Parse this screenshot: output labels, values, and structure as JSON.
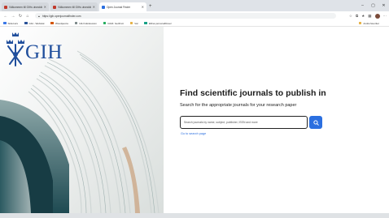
{
  "browser": {
    "tabs": [
      {
        "label": "Välkommen till GIHs utvecklings...",
        "favicon_color": "#c0392b",
        "active": false
      },
      {
        "label": "Välkommen till GIHs utvecklings...",
        "favicon_color": "#c0392b",
        "active": false
      },
      {
        "label": "Open Journal Finder",
        "favicon_color": "#2b6fe0",
        "active": true
      }
    ],
    "new_tab_icon": "plus-icon",
    "address": "https://gih.openjournalfinder.com",
    "bookmarks": [
      {
        "label": "Sida kurs",
        "color": "#3b78e7"
      },
      {
        "label": "GIH - Webstat",
        "color": "#2a5298"
      },
      {
        "label": "Woodpecca",
        "color": "#d35400"
      },
      {
        "label": "GIH Gävlesoran",
        "color": "#7f8c8d"
      },
      {
        "label": "GIHb: GetFruit",
        "color": "#27ae60"
      },
      {
        "label": "Val",
        "color": "#e67e22"
      },
      {
        "label": "Ellina personalblovel",
        "color": "#16a085"
      }
    ],
    "other_bookmarks": "Andra favoriter"
  },
  "brand": {
    "logo_text": "GIH",
    "logo_color": "#1f4e9c"
  },
  "main": {
    "headline": "Find scientific journals to publish in",
    "subline": "Search for the appropriate journals for your research paper",
    "search_placeholder": "Search journals by name, subject, publisher, ISSN and more",
    "search_button_color": "#2b6fe0",
    "advanced_link": "Go to search page"
  }
}
